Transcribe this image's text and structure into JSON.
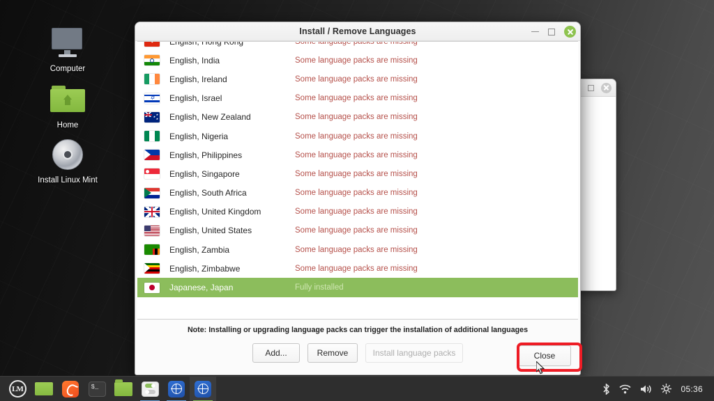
{
  "desktop": {
    "icons": [
      {
        "label": "Computer",
        "icon": "computer-monitor-icon"
      },
      {
        "label": "Home",
        "icon": "home-folder-icon"
      },
      {
        "label": "Install Linux Mint",
        "icon": "cd-disc-icon"
      }
    ]
  },
  "dialog": {
    "title": "Install / Remove Languages",
    "window_buttons": {
      "minimize": "minimize-icon",
      "maximize": "maximize-icon",
      "close": "close-icon"
    },
    "note": "Note: Installing or upgrading language packs can trigger the installation of additional languages",
    "buttons": {
      "add": "Add...",
      "remove": "Remove",
      "install": "Install language packs",
      "close": "Close"
    },
    "status_missing": "Some language packs are missing",
    "status_installed": "Fully installed",
    "colors": {
      "selection": "#8cbd5c",
      "status_missing": "#b5504a",
      "highlight": "#ee1c25"
    },
    "rows": [
      {
        "name": "English, Hong Kong",
        "status": "Some language packs are missing",
        "selected": false
      },
      {
        "name": "English, India",
        "status": "Some language packs are missing",
        "selected": false
      },
      {
        "name": "English, Ireland",
        "status": "Some language packs are missing",
        "selected": false
      },
      {
        "name": "English, Israel",
        "status": "Some language packs are missing",
        "selected": false
      },
      {
        "name": "English, New Zealand",
        "status": "Some language packs are missing",
        "selected": false
      },
      {
        "name": "English, Nigeria",
        "status": "Some language packs are missing",
        "selected": false
      },
      {
        "name": "English, Philippines",
        "status": "Some language packs are missing",
        "selected": false
      },
      {
        "name": "English, Singapore",
        "status": "Some language packs are missing",
        "selected": false
      },
      {
        "name": "English, South Africa",
        "status": "Some language packs are missing",
        "selected": false
      },
      {
        "name": "English, United Kingdom",
        "status": "Some language packs are missing",
        "selected": false
      },
      {
        "name": "English, United States",
        "status": "Some language packs are missing",
        "selected": false
      },
      {
        "name": "English, Zambia",
        "status": "Some language packs are missing",
        "selected": false
      },
      {
        "name": "English, Zimbabwe",
        "status": "Some language packs are missing",
        "selected": false
      },
      {
        "name": "Japanese, Japan",
        "status": "Fully installed",
        "selected": true
      }
    ]
  },
  "taskbar": {
    "items": [
      {
        "icon": "mint-menu-icon",
        "label": "LM",
        "state": "normal"
      },
      {
        "icon": "show-desktop-icon",
        "label": "",
        "state": "normal"
      },
      {
        "icon": "firefox-icon",
        "label": "",
        "state": "normal"
      },
      {
        "icon": "terminal-icon",
        "label": "$_",
        "state": "normal"
      },
      {
        "icon": "files-icon",
        "label": "",
        "state": "normal"
      },
      {
        "icon": "software-manager-icon",
        "label": "",
        "state": "running"
      },
      {
        "icon": "language-settings-icon",
        "label": "",
        "state": "running"
      },
      {
        "icon": "language-settings-icon",
        "label": "",
        "state": "active"
      }
    ],
    "tray": [
      {
        "icon": "bluetooth-icon"
      },
      {
        "icon": "wifi-icon"
      },
      {
        "icon": "volume-icon"
      },
      {
        "icon": "brightness-icon"
      }
    ],
    "clock": "05:36"
  }
}
